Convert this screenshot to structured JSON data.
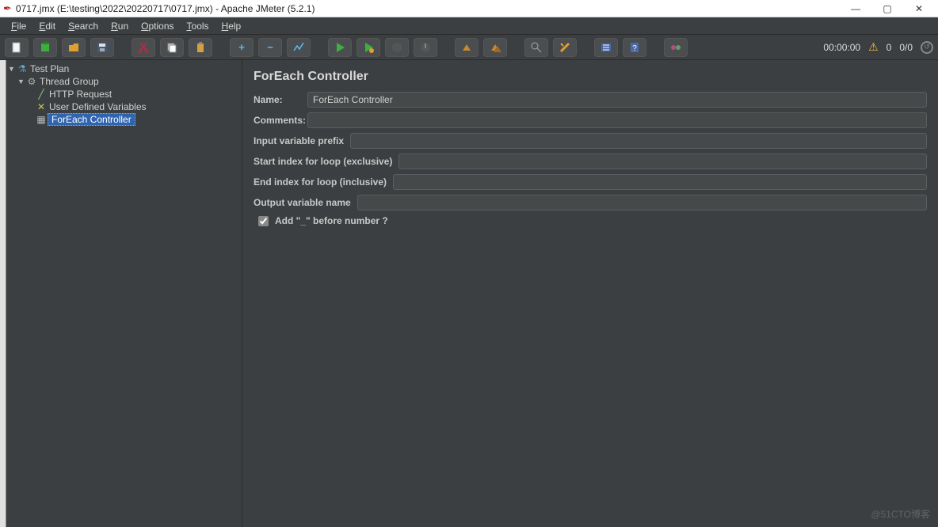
{
  "window": {
    "title": "0717.jmx (E:\\testing\\2022\\20220717\\0717.jmx) - Apache JMeter (5.2.1)"
  },
  "menus": {
    "file": "File",
    "edit": "Edit",
    "search": "Search",
    "run": "Run",
    "options": "Options",
    "tools": "Tools",
    "help": "Help"
  },
  "toolbar_status": {
    "time": "00:00:00",
    "warn_count": "0",
    "threads": "0/0"
  },
  "tree": {
    "test_plan": "Test Plan",
    "thread_group": "Thread Group",
    "http_request": "HTTP Request",
    "user_vars": "User Defined Variables",
    "foreach": "ForEach Controller"
  },
  "panel": {
    "heading": "ForEach Controller",
    "labels": {
      "name": "Name:",
      "comments": "Comments:",
      "input_prefix": "Input variable prefix",
      "start_index": "Start index for loop (exclusive)",
      "end_index": "End index for loop (inclusive)",
      "output_name": "Output variable name",
      "add_underscore": "Add \"_\" before number ?"
    },
    "values": {
      "name": "ForEach Controller",
      "comments": "",
      "input_prefix": "",
      "start_index": "",
      "end_index": "",
      "output_name": "",
      "add_underscore_checked": true
    }
  },
  "watermark": "@51CTO博客"
}
